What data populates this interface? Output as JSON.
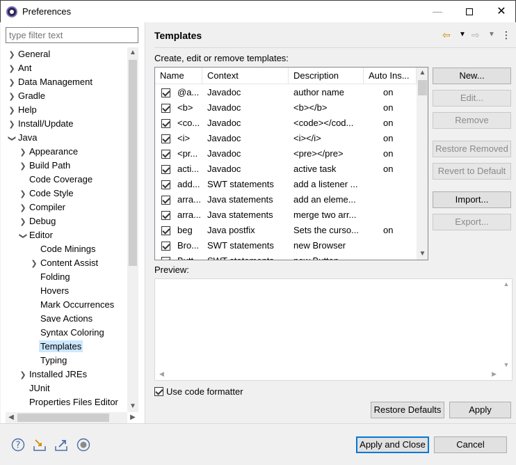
{
  "window": {
    "title": "Preferences"
  },
  "sidebar": {
    "filter_placeholder": "type filter text",
    "items": [
      {
        "label": "General",
        "level": 0,
        "arrow": ">"
      },
      {
        "label": "Ant",
        "level": 0,
        "arrow": ">"
      },
      {
        "label": "Data Management",
        "level": 0,
        "arrow": ">"
      },
      {
        "label": "Gradle",
        "level": 0,
        "arrow": ">"
      },
      {
        "label": "Help",
        "level": 0,
        "arrow": ">"
      },
      {
        "label": "Install/Update",
        "level": 0,
        "arrow": ">"
      },
      {
        "label": "Java",
        "level": 0,
        "arrow": "v"
      },
      {
        "label": "Appearance",
        "level": 1,
        "arrow": ">"
      },
      {
        "label": "Build Path",
        "level": 1,
        "arrow": ">"
      },
      {
        "label": "Code Coverage",
        "level": 1,
        "arrow": ""
      },
      {
        "label": "Code Style",
        "level": 1,
        "arrow": ">"
      },
      {
        "label": "Compiler",
        "level": 1,
        "arrow": ">"
      },
      {
        "label": "Debug",
        "level": 1,
        "arrow": ">"
      },
      {
        "label": "Editor",
        "level": 1,
        "arrow": "v"
      },
      {
        "label": "Code Minings",
        "level": 2,
        "arrow": ""
      },
      {
        "label": "Content Assist",
        "level": 2,
        "arrow": ">"
      },
      {
        "label": "Folding",
        "level": 2,
        "arrow": ""
      },
      {
        "label": "Hovers",
        "level": 2,
        "arrow": ""
      },
      {
        "label": "Mark Occurrences",
        "level": 2,
        "arrow": ""
      },
      {
        "label": "Save Actions",
        "level": 2,
        "arrow": ""
      },
      {
        "label": "Syntax Coloring",
        "level": 2,
        "arrow": ""
      },
      {
        "label": "Templates",
        "level": 2,
        "arrow": "",
        "selected": true
      },
      {
        "label": "Typing",
        "level": 2,
        "arrow": ""
      },
      {
        "label": "Installed JREs",
        "level": 1,
        "arrow": ">"
      },
      {
        "label": "JUnit",
        "level": 1,
        "arrow": ""
      },
      {
        "label": "Properties Files Editor",
        "level": 1,
        "arrow": ""
      }
    ]
  },
  "page": {
    "title": "Templates",
    "subtitle": "Create, edit or remove templates:",
    "columns": [
      "Name",
      "Context",
      "Description",
      "Auto Ins..."
    ],
    "rows": [
      {
        "name": "@a...",
        "context": "Javadoc",
        "description": "author name",
        "auto": "on"
      },
      {
        "name": "<b>",
        "context": "Javadoc",
        "description": "<b></b>",
        "auto": "on"
      },
      {
        "name": "<co...",
        "context": "Javadoc",
        "description": "<code></cod...",
        "auto": "on"
      },
      {
        "name": "<i>",
        "context": "Javadoc",
        "description": "<i></i>",
        "auto": "on"
      },
      {
        "name": "<pr...",
        "context": "Javadoc",
        "description": "<pre></pre>",
        "auto": "on"
      },
      {
        "name": "acti...",
        "context": "Javadoc",
        "description": "active task",
        "auto": "on"
      },
      {
        "name": "add...",
        "context": "SWT statements",
        "description": "add a listener ...",
        "auto": ""
      },
      {
        "name": "arra...",
        "context": "Java statements",
        "description": "add an eleme...",
        "auto": ""
      },
      {
        "name": "arra...",
        "context": "Java statements",
        "description": "merge two arr...",
        "auto": ""
      },
      {
        "name": "beg",
        "context": "Java postfix",
        "description": "Sets the curso...",
        "auto": "on"
      },
      {
        "name": "Bro...",
        "context": "SWT statements",
        "description": "new Browser",
        "auto": ""
      },
      {
        "name": "Butt...",
        "context": "SWT statements",
        "description": "new Button",
        "auto": ""
      }
    ],
    "buttons": {
      "new": "New...",
      "edit": "Edit...",
      "remove": "Remove",
      "restore_removed": "Restore Removed",
      "revert_default": "Revert to Default",
      "import": "Import...",
      "export": "Export..."
    },
    "preview_label": "Preview:",
    "use_formatter": "Use code formatter",
    "restore_defaults": "Restore Defaults",
    "apply": "Apply"
  },
  "footer": {
    "apply_close": "Apply and Close",
    "cancel": "Cancel",
    "icons": [
      "help-icon",
      "import-icon",
      "export-icon",
      "record-icon"
    ]
  }
}
